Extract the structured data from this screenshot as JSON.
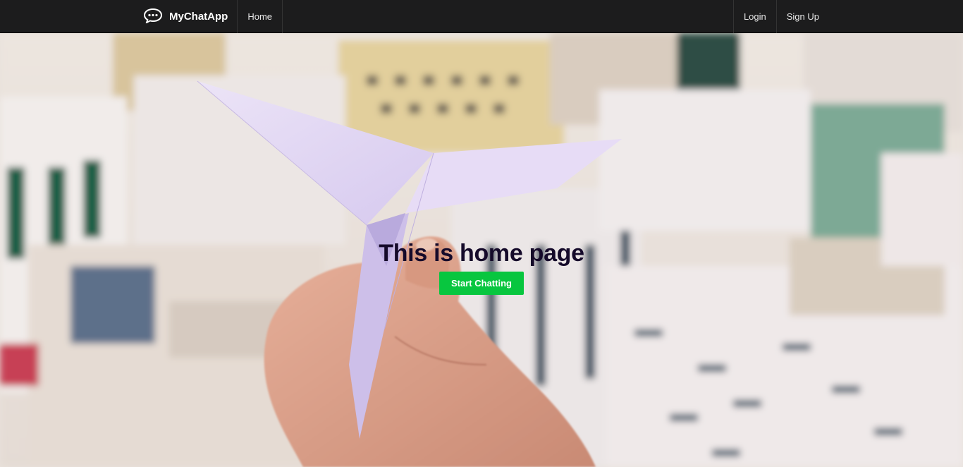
{
  "navbar": {
    "brand": "MyChatApp",
    "brand_icon": "chat-bubble-icon",
    "home_label": "Home",
    "login_label": "Login",
    "signup_label": "Sign Up"
  },
  "hero": {
    "title": "This is home page",
    "cta_label": "Start Chatting"
  },
  "colors": {
    "navbar_bg": "#1c1c1d",
    "cta_bg": "#08c63f",
    "title_color": "#150a2a"
  }
}
